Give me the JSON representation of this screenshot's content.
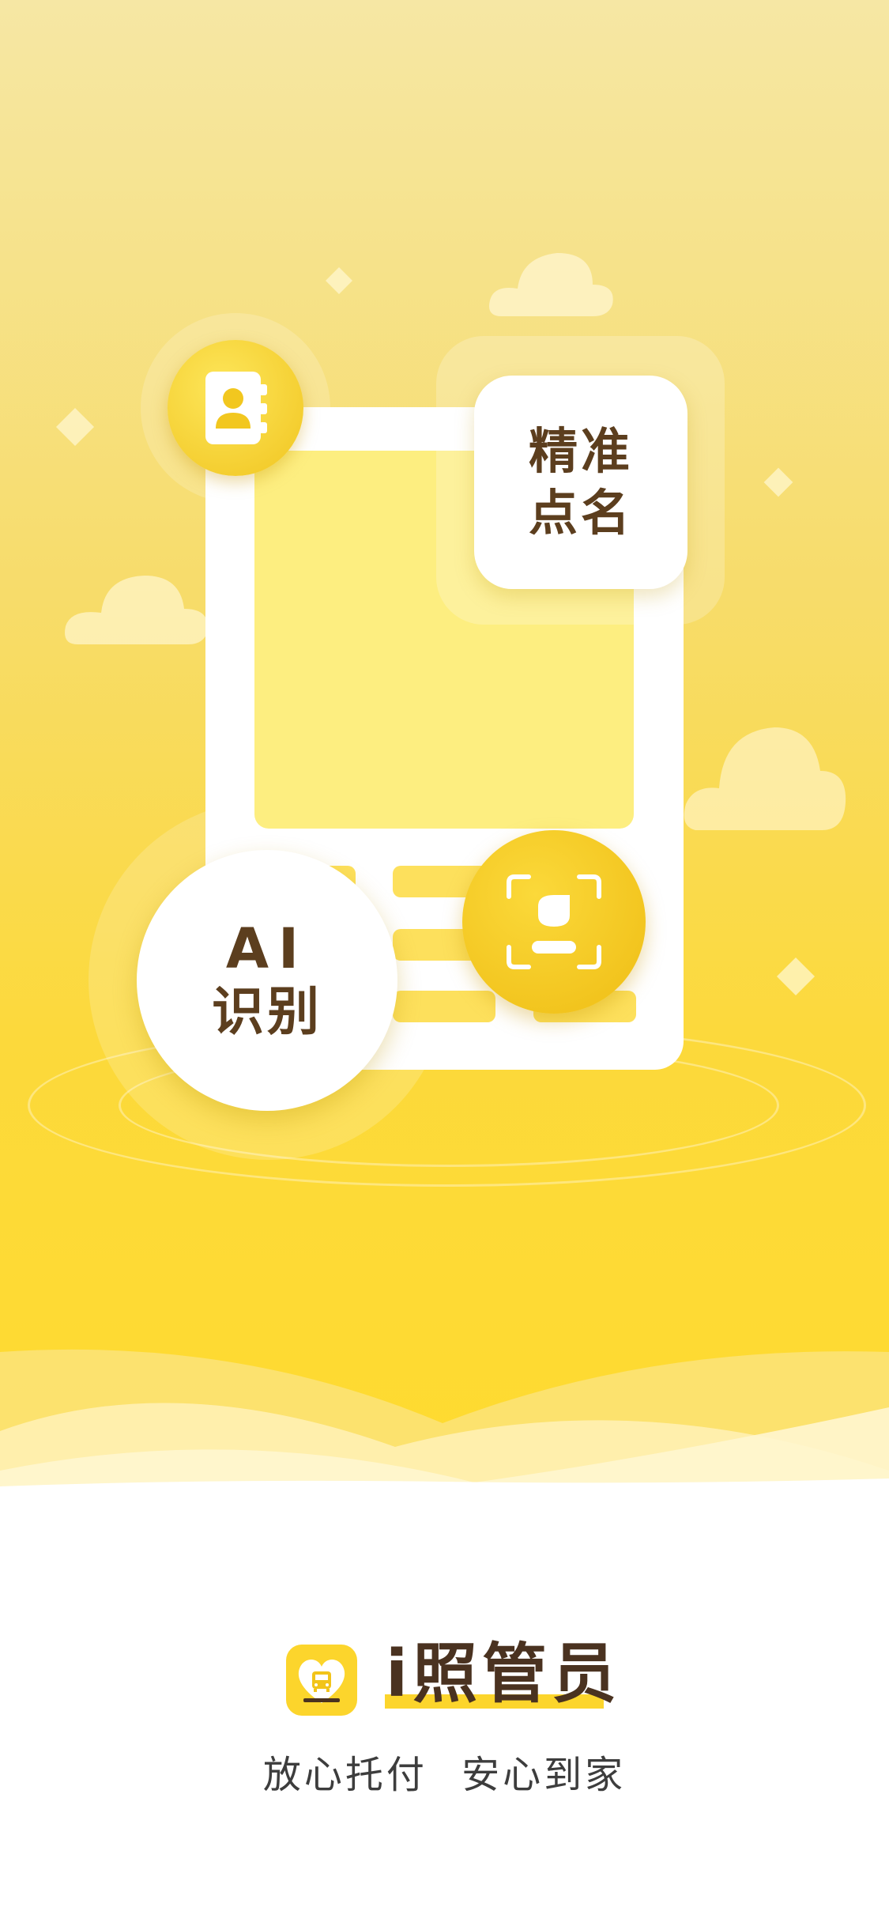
{
  "hero": {
    "card_top_label_line1": "精准",
    "card_top_label_line2": "点名",
    "circle_label_line1": "AI",
    "circle_label_line2": "识别",
    "icons": [
      "contact-book-icon",
      "face-scan-icon"
    ],
    "colors": {
      "brand_yellow": "#fcd52c",
      "text_brown": "#5c3e1e"
    }
  },
  "brand": {
    "name_prefix": "i",
    "name_main": "照管员",
    "icon": "school-bus-heart-icon"
  },
  "slogan": {
    "part1": "放心托付",
    "part2": "安心到家"
  }
}
